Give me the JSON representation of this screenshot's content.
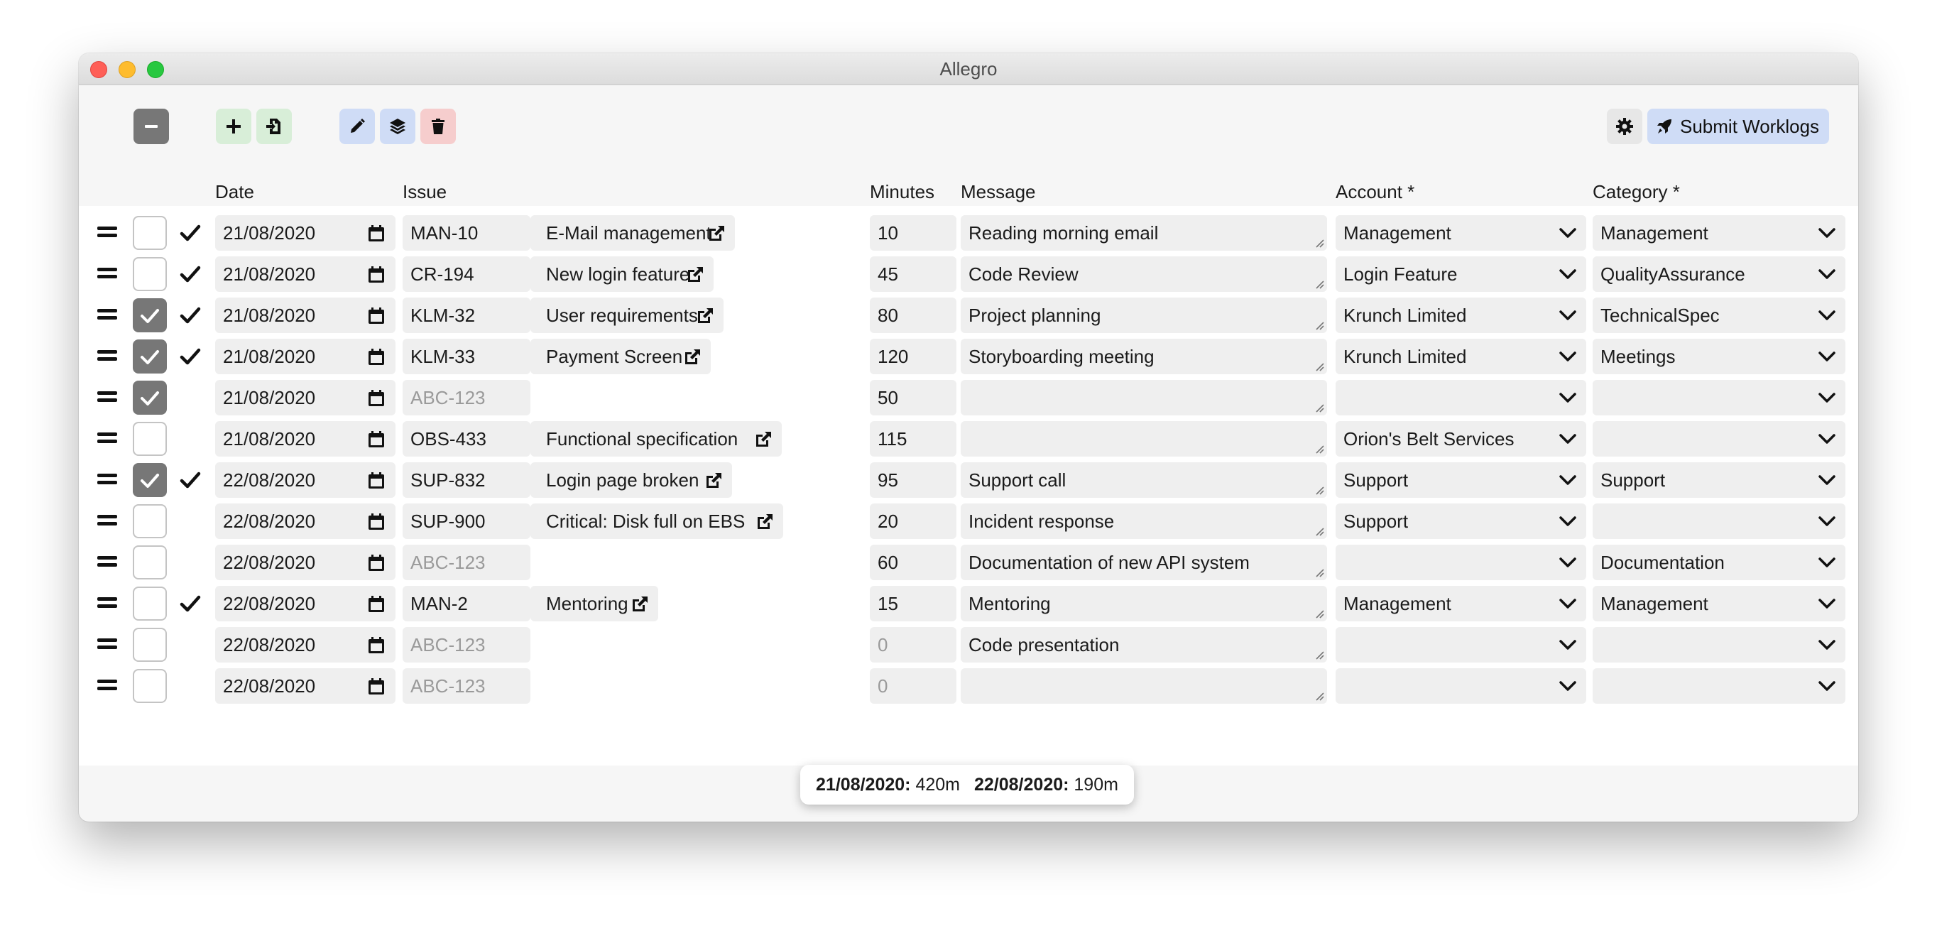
{
  "window": {
    "title": "Allegro"
  },
  "toolbar": {
    "collapse_icon": "minus-icon",
    "add_icon": "plus-icon",
    "import_icon": "file-import-icon",
    "edit_icon": "pencil-icon",
    "layers_icon": "layers-icon",
    "delete_icon": "trash-icon",
    "settings_icon": "gear-icon",
    "submit_icon": "rocket-icon",
    "submit_label": "Submit Worklogs",
    "colors": {
      "gray": "#777777",
      "green": "#d8eed8",
      "blue": "#cfdcf6",
      "red": "#f6cdcd",
      "settings": "#e7e7e7"
    }
  },
  "headers": {
    "date": "Date",
    "issue": "Issue",
    "minutes": "Minutes",
    "message": "Message",
    "account": "Account *",
    "category": "Category *"
  },
  "placeholder_issue": "ABC-123",
  "rows": [
    {
      "checked": false,
      "ticked": true,
      "date": "21/08/2020",
      "issue": "MAN-10",
      "summary": "E-Mail management",
      "minutes": "10",
      "message": "Reading morning email",
      "account": "Management",
      "category": "Management"
    },
    {
      "checked": false,
      "ticked": true,
      "date": "21/08/2020",
      "issue": "CR-194",
      "summary": "New login feature",
      "minutes": "45",
      "message": "Code Review",
      "account": "Login Feature",
      "category": "QualityAssurance"
    },
    {
      "checked": true,
      "ticked": true,
      "date": "21/08/2020",
      "issue": "KLM-32",
      "summary": "User requirements",
      "minutes": "80",
      "message": "Project planning",
      "account": "Krunch Limited",
      "category": "TechnicalSpec"
    },
    {
      "checked": true,
      "ticked": true,
      "date": "21/08/2020",
      "issue": "KLM-33",
      "summary": "Payment Screen",
      "minutes": "120",
      "message": "Storyboarding meeting",
      "account": "Krunch Limited",
      "category": "Meetings"
    },
    {
      "checked": true,
      "ticked": false,
      "date": "21/08/2020",
      "issue": "",
      "summary": "",
      "minutes": "50",
      "message": "",
      "account": "",
      "category": ""
    },
    {
      "checked": false,
      "ticked": false,
      "date": "21/08/2020",
      "issue": "OBS-433",
      "summary": "Functional specification",
      "minutes": "115",
      "message": "",
      "account": "Orion's Belt Services",
      "category": ""
    },
    {
      "checked": true,
      "ticked": true,
      "date": "22/08/2020",
      "issue": "SUP-832",
      "summary": "Login page broken",
      "minutes": "95",
      "message": "Support call",
      "account": "Support",
      "category": "Support"
    },
    {
      "checked": false,
      "ticked": false,
      "date": "22/08/2020",
      "issue": "SUP-900",
      "summary": "Critical: Disk full on EBS",
      "minutes": "20",
      "message": "Incident response",
      "account": "Support",
      "category": ""
    },
    {
      "checked": false,
      "ticked": false,
      "date": "22/08/2020",
      "issue": "",
      "summary": "",
      "minutes": "60",
      "message": "Documentation of new API system",
      "account": "",
      "category": "Documentation"
    },
    {
      "checked": false,
      "ticked": true,
      "date": "22/08/2020",
      "issue": "MAN-2",
      "summary": "Mentoring",
      "minutes": "15",
      "message": "Mentoring",
      "account": "Management",
      "category": "Management"
    },
    {
      "checked": false,
      "ticked": false,
      "date": "22/08/2020",
      "issue": "",
      "summary": "",
      "minutes": "0",
      "message": "Code presentation",
      "account": "",
      "category": ""
    },
    {
      "checked": false,
      "ticked": false,
      "date": "22/08/2020",
      "issue": "",
      "summary": "",
      "minutes": "0",
      "message": "",
      "account": "",
      "category": ""
    }
  ],
  "totals": [
    {
      "date": "21/08/2020:",
      "value": "420m"
    },
    {
      "date": "22/08/2020:",
      "value": "190m"
    }
  ]
}
